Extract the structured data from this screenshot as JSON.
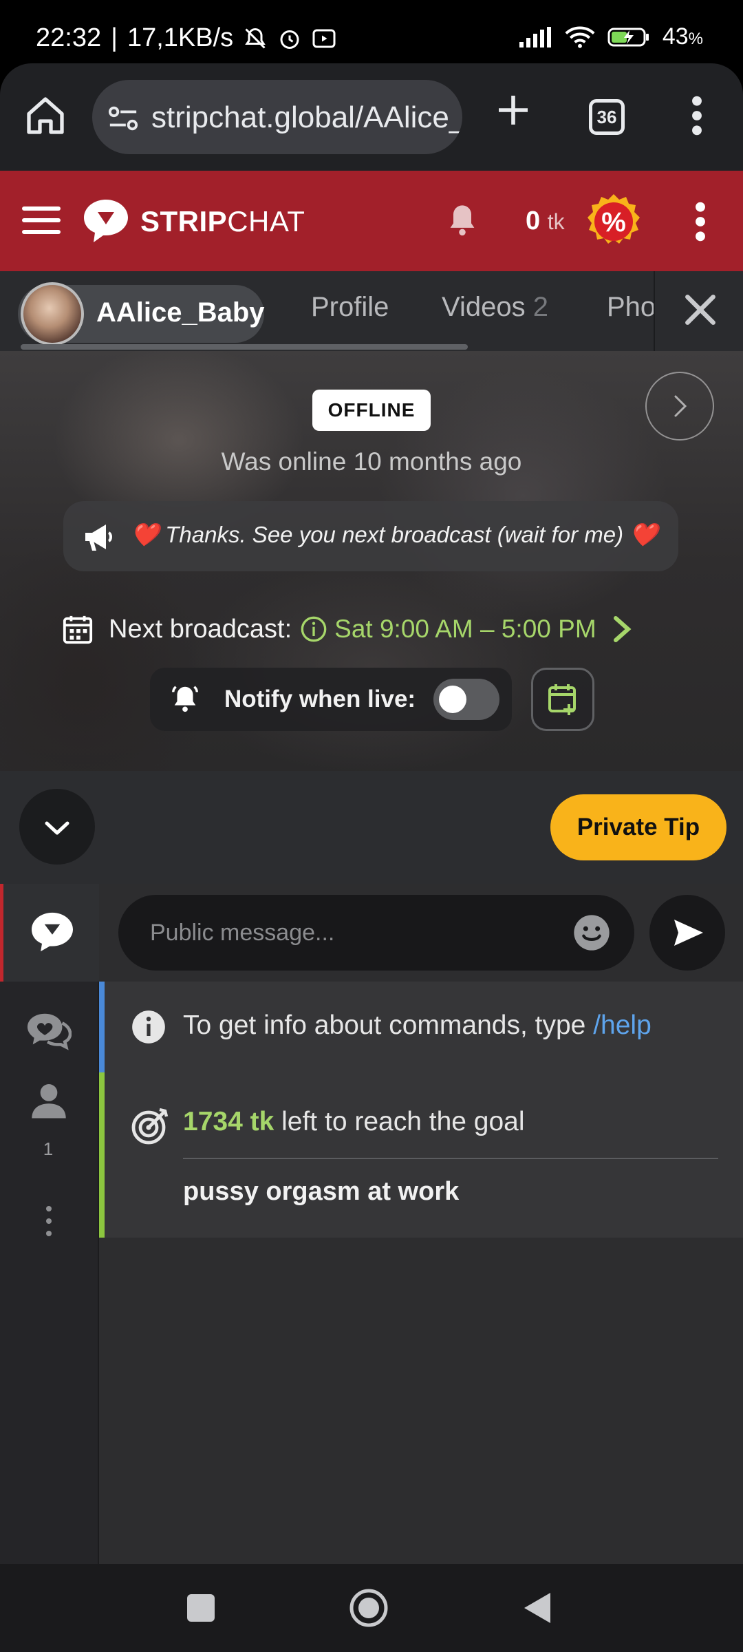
{
  "status_bar": {
    "time": "22:32",
    "speed": "17,1KB/s",
    "battery": "43",
    "battery_unit": "%"
  },
  "browser": {
    "url": "stripchat.global/AAlice_Baby",
    "tab_count": "36"
  },
  "site_header": {
    "logo_bold": "STRIP",
    "logo_light": "CHAT",
    "token_balance": "0",
    "token_unit": "tk",
    "promo_symbol": "%"
  },
  "profile_tabs": {
    "username": "AAlice_Baby",
    "tabs": [
      {
        "label": "Profile",
        "count": ""
      },
      {
        "label": "Videos",
        "count": "2"
      },
      {
        "label": "Photos",
        "count": ""
      }
    ]
  },
  "hero": {
    "status_badge": "OFFLINE",
    "last_seen": "Was online 10 months ago",
    "announcement": "❤️ Thanks. See you next broadcast (wait for me) ❤️",
    "next_broadcast_label": "Next broadcast:",
    "next_broadcast_time": "Sat 9:00 AM – 5:00 PM",
    "notify_label": "Notify when live:",
    "notify_enabled": false
  },
  "controls": {
    "private_tip_label": "Private Tip"
  },
  "chat": {
    "input_placeholder": "Public message...",
    "users_count": "1",
    "info_message_prefix": "To get info about commands, type ",
    "info_message_command": "/help",
    "goal_amount": "1734 tk",
    "goal_text": " left to reach the goal",
    "goal_name": "pussy orgasm at work"
  },
  "colors": {
    "brand_red": "#a2202a",
    "accent_green": "#a6d66a",
    "accent_yellow": "#f9b31a",
    "link_blue": "#5ea4ec"
  }
}
